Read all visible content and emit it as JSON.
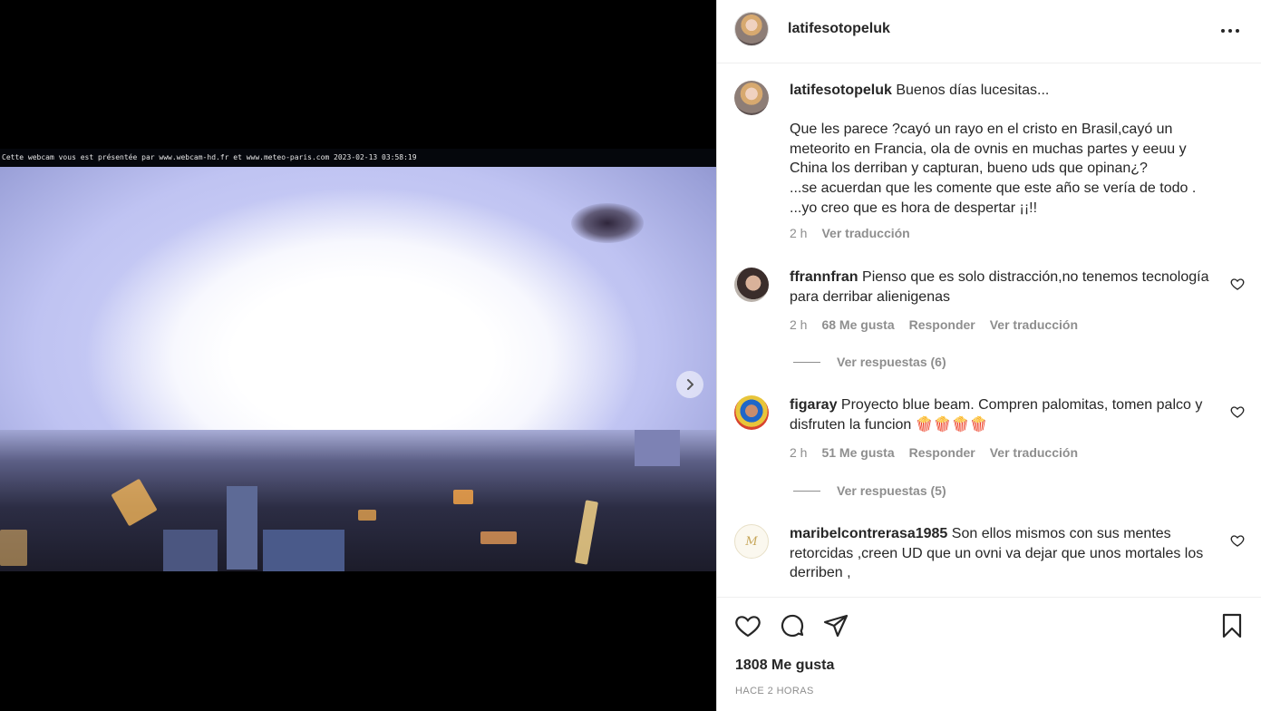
{
  "media": {
    "overlay_text": "Cette webcam vous est présentée par www.webcam-hd.fr et www.meteo-paris.com 2023-02-13 03:58:19"
  },
  "post": {
    "username": "latifesotopeluk",
    "caption_first_line": "Buenos días lucesitas...",
    "caption_lines": [
      "Que les parece ?cayó un rayo en el cristo en Brasil,cayó un",
      "meteorito en Francia, ola de ovnis en muchas partes y eeuu y",
      "China los derriban y capturan, bueno uds que opinan¿?",
      "...se acuerdan que les comente que este año se vería de todo .",
      "...yo creo que es hora de despertar ¡¡!!"
    ],
    "caption_time": "2 h",
    "caption_translate": "Ver traducción"
  },
  "comments": [
    {
      "username": "ffrannfran",
      "text": "Pienso que es solo distracción,no tenemos tecnología para derribar alienigenas",
      "time": "2 h",
      "likes": "68 Me gusta",
      "reply": "Responder",
      "translate": "Ver traducción",
      "replies": "Ver respuestas (6)"
    },
    {
      "username": "figaray",
      "text": "Proyecto blue beam. Compren palomitas, tomen palco y disfruten la funcion 🍿🍿🍿🍿",
      "time": "2 h",
      "likes": "51 Me gusta",
      "reply": "Responder",
      "translate": "Ver traducción",
      "replies": "Ver respuestas (5)"
    },
    {
      "username": "maribelcontrerasa1985",
      "text": "Son ellos mismos con sus mentes retorcidas ,creen UD que un ovni va dejar que unos mortales los derriben ,"
    }
  ],
  "footer": {
    "likes": "1808 Me gusta",
    "timestamp": "HACE 2 HORAS"
  },
  "icons": {
    "more": "more-options-icon",
    "next": "chevron-right-icon",
    "like": "heart-icon",
    "comment": "comment-icon",
    "share": "send-icon",
    "save": "bookmark-icon"
  }
}
